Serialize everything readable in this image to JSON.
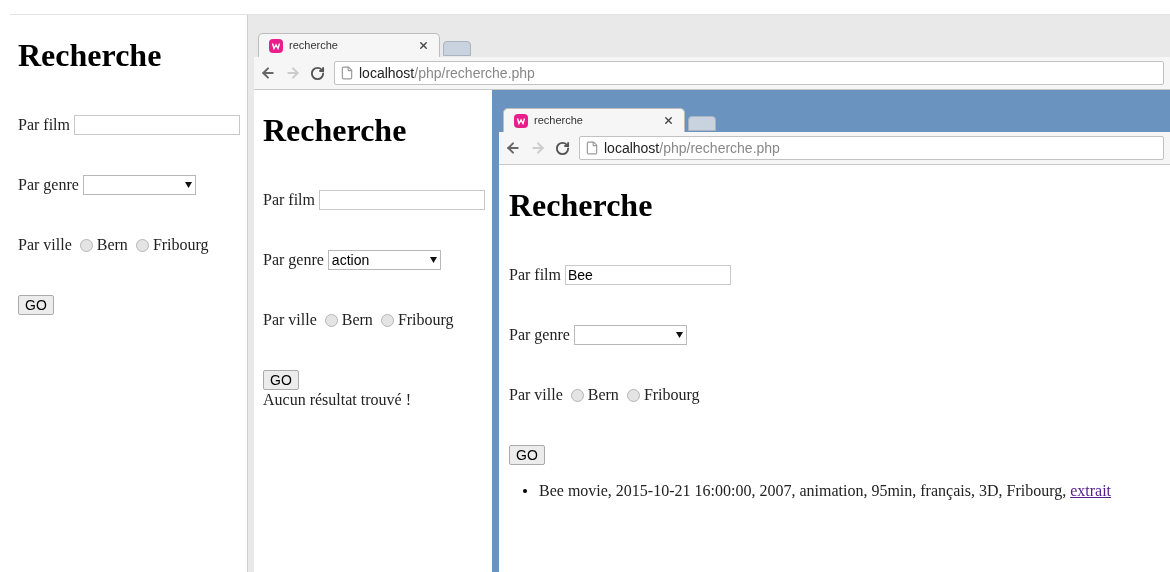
{
  "page": {
    "title": "Recherche",
    "film": {
      "label": "Par film"
    },
    "genre": {
      "label": "Par genre"
    },
    "ville": {
      "label": "Par ville",
      "options": [
        {
          "label": "Bern",
          "selected": false
        },
        {
          "label": "Fribourg",
          "selected": false
        }
      ]
    },
    "button": "GO"
  },
  "browser": {
    "tab": "recherche",
    "host": "localhost",
    "path": "/php/recherche.php",
    "page": {
      "title": "Recherche",
      "film": {
        "label": "Par film"
      },
      "genre": {
        "label": "Par genre",
        "value": "action"
      },
      "ville": {
        "label": "Par ville",
        "options": [
          {
            "label": "Bern",
            "selected": false
          },
          {
            "label": "Fribourg",
            "selected": false
          }
        ]
      },
      "button": "GO",
      "message": "Aucun résultat trouvé !"
    },
    "inner_browser": {
      "tab": "recherche",
      "host": "localhost",
      "path": "/php/recherche.php",
      "page": {
        "title": "Recherche",
        "film": {
          "label": "Par film",
          "value": "Bee"
        },
        "genre": {
          "label": "Par genre"
        },
        "ville": {
          "label": "Par ville",
          "options": [
            {
              "label": "Bern",
              "selected": false
            },
            {
              "label": "Fribourg",
              "selected": false
            }
          ]
        },
        "button": "GO",
        "results": [
          {
            "text": "Bee movie, 2015-10-21 16:00:00, 2007, animation, 95min, français, 3D, Fribourg,",
            "link": "extrait"
          }
        ]
      }
    }
  }
}
